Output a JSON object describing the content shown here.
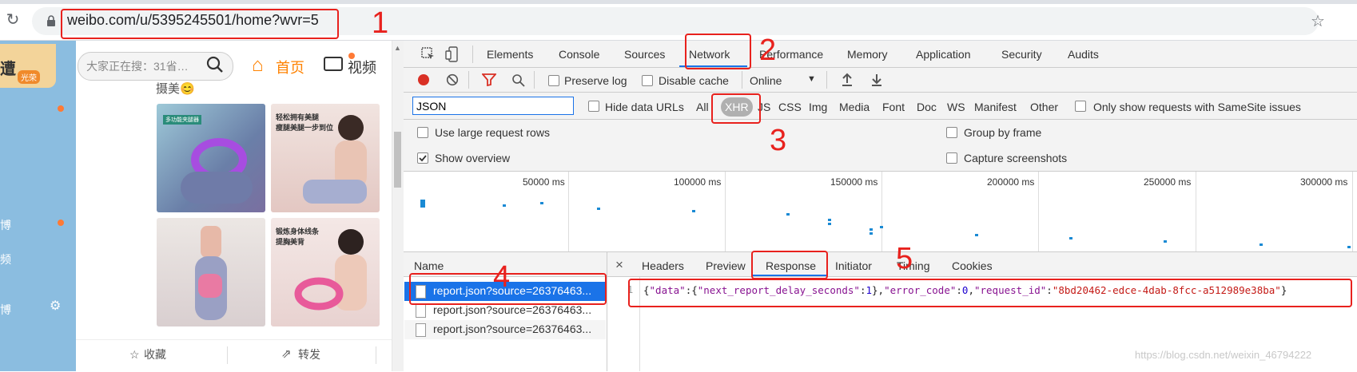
{
  "browser": {
    "url": "weibo.com/u/5395245501/home?wvr=5"
  },
  "weibo": {
    "logo_text": "遭",
    "logo_badge": "光荣",
    "search_placeholder": "大家正在搜：31省…",
    "home_label": "首页",
    "video_label": "视频",
    "nav_items": [
      "博",
      "频",
      "博"
    ],
    "post_fragment": "摄美😊",
    "thumb_captions": [
      "多功能夹腿器",
      "轻松拥有美腿\n瘦腿美腿一步到位",
      "",
      "锻炼身体线条\n提胸美背"
    ],
    "action_fav": "收藏",
    "action_fwd": "转发"
  },
  "devtools": {
    "tabs": [
      "Elements",
      "Console",
      "Sources",
      "Network",
      "Performance",
      "Memory",
      "Application",
      "Security",
      "Audits"
    ],
    "active_tab": "Network",
    "toolbar": {
      "preserve_log": "Preserve log",
      "disable_cache": "Disable cache",
      "throttle": "Online"
    },
    "filter": {
      "value": "JSON",
      "hide_data_urls": "Hide data URLs",
      "types": [
        "All",
        "XHR",
        "JS",
        "CSS",
        "Img",
        "Media",
        "Font",
        "Doc",
        "WS",
        "Manifest",
        "Other"
      ],
      "active_type": "XHR",
      "samesite": "Only show requests with SameSite issues"
    },
    "settings": {
      "large_rows": "Use large request rows",
      "show_overview": "Show overview",
      "group_by_frame": "Group by frame",
      "capture_screenshots": "Capture screenshots"
    },
    "overview_ticks": [
      "50000 ms",
      "100000 ms",
      "150000 ms",
      "200000 ms",
      "250000 ms",
      "300000 ms"
    ],
    "requests": {
      "header": "Name",
      "rows": [
        "report.json?source=26376463...",
        "report.json?source=26376463...",
        "report.json?source=26376463..."
      ]
    },
    "detail": {
      "close": "×",
      "tabs": [
        "Headers",
        "Preview",
        "Response",
        "Initiator",
        "Timing",
        "Cookies"
      ],
      "active_tab": "Response",
      "line_number": "1",
      "response": {
        "open": "{",
        "k_data": "\"data\"",
        "colon1": ":{",
        "k_delay": "\"next_report_delay_seconds\"",
        "colon2": ":",
        "v_delay": "1",
        "close1": "},",
        "k_error": "\"error_code\"",
        "colon3": ":",
        "v_error": "0",
        "comma": ",",
        "k_req": "\"request_id\"",
        "colon4": ":",
        "v_req": "\"8bd20462-edce-4dab-8fcc-a512989e38ba\"",
        "close2": "}"
      }
    }
  },
  "annotations": [
    "1",
    "2",
    "3",
    "4",
    "5"
  ],
  "watermark": "https://blog.csdn.net/weixin_46794222",
  "colors": {
    "annotation_red": "#e8211d",
    "selection_blue": "#1a73e8",
    "weibo_orange": "#ff8200"
  }
}
